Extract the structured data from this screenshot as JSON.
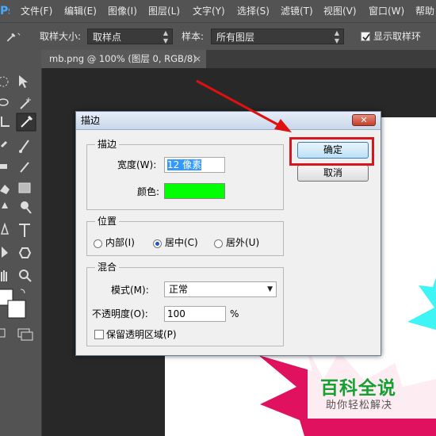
{
  "app": {
    "menu": [
      "文件(F)",
      "编辑(E)",
      "图像(I)",
      "图层(L)",
      "文字(Y)",
      "选择(S)",
      "滤镜(T)",
      "视图(V)",
      "窗口(W)",
      "帮助"
    ],
    "logo": "Ps"
  },
  "options_bar": {
    "sample_size_label": "取样大小:",
    "sample_size_value": "取样点",
    "sample_label": "样本:",
    "sample_value": "所有图层",
    "show_ring_label": "显示取样环",
    "show_ring_checked": true
  },
  "document_tab": {
    "title": "mb.png @ 100% (图层 0, RGB/8)",
    "close": "×"
  },
  "dialog": {
    "title": "描边",
    "close": "✕",
    "stroke_group": "描边",
    "width_label": "宽度(W):",
    "width_value": "12 像素",
    "color_label": "颜色:",
    "color_value": "#00ff00",
    "position_group": "位置",
    "position_options": [
      "内部(I)",
      "居中(C)",
      "居外(U)"
    ],
    "position_selected": 1,
    "blend_group": "混合",
    "mode_label": "模式(M):",
    "mode_value": "正常",
    "opacity_label": "不透明度(O):",
    "opacity_value": "100",
    "opacity_unit": "%",
    "preserve_label": "保留透明区域(P)",
    "preserve_checked": false,
    "ok_label": "确定",
    "cancel_label": "取消"
  },
  "watermark": {
    "title": "百科全说",
    "subtitle": "助你轻松解决"
  },
  "colors": {
    "highlight": "#d9141a",
    "stroke_color": "#00ff00",
    "shape_cyan": "#3ff4f4",
    "shape_magenta": "#e0115f"
  },
  "tools": [
    "move-icon",
    "marquee-icon",
    "lasso-icon",
    "magic-wand-icon",
    "crop-icon",
    "eyedropper-icon",
    "healing-brush-icon",
    "brush-icon",
    "clone-stamp-icon",
    "history-brush-icon",
    "eraser-icon",
    "gradient-icon",
    "blur-icon",
    "dodge-icon",
    "pen-icon",
    "type-icon",
    "path-selection-icon",
    "shape-icon",
    "hand-icon",
    "zoom-icon"
  ]
}
